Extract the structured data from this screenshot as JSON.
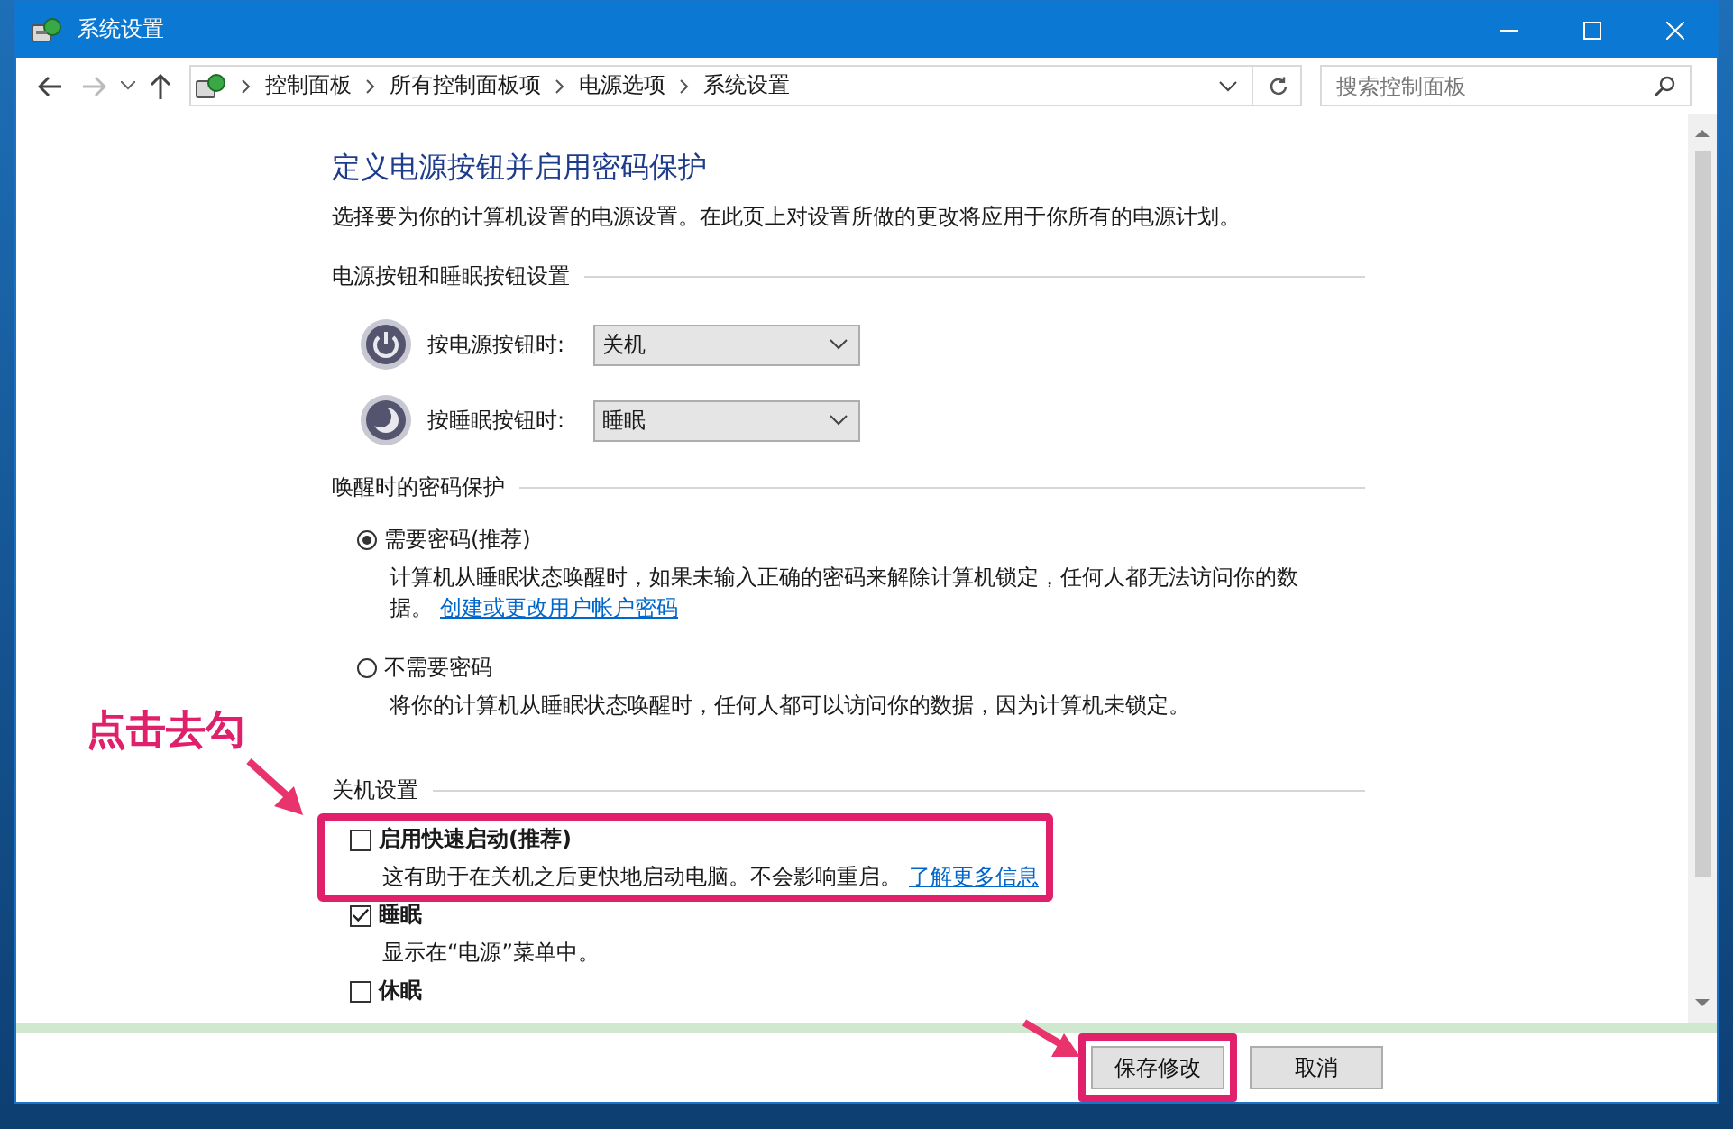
{
  "window": {
    "title": "系统设置"
  },
  "address_bar": {
    "breadcrumbs": [
      "控制面板",
      "所有控制面板项",
      "电源选项",
      "系统设置"
    ]
  },
  "search": {
    "placeholder": "搜索控制面板"
  },
  "heading": "定义电源按钮并启用密码保护",
  "description": "选择要为你的计算机设置的电源设置。在此页上对设置所做的更改将应用于你所有的电源计划。",
  "power_section": {
    "title": "电源按钮和睡眠按钮设置",
    "rows": [
      {
        "kind": "power",
        "label": "按电源按钮时:",
        "value": "关机"
      },
      {
        "kind": "sleep",
        "label": "按睡眠按钮时:",
        "value": "睡眠"
      }
    ]
  },
  "password_section": {
    "title": "唤醒时的密码保护",
    "options": [
      {
        "label": "需要密码(推荐)",
        "description": "计算机从睡眠状态唤醒时，如果未输入正确的密码来解除计算机锁定，任何人都无法访问你的数据。",
        "link": "创建或更改用户帐户密码",
        "selected": true
      },
      {
        "label": "不需要密码",
        "description": "将你的计算机从睡眠状态唤醒时，任何人都可以访问你的数据，因为计算机未锁定。",
        "selected": false
      }
    ]
  },
  "shutdown_section": {
    "title": "关机设置",
    "options": [
      {
        "label": "启用快速启动(推荐)",
        "description": "这有助于在关机之后更快地启动电脑。不会影响重启。",
        "link": "了解更多信息",
        "checked": false,
        "highlighted": true
      },
      {
        "label": "睡眠",
        "description": "显示在“电源”菜单中。",
        "checked": true,
        "highlighted": false
      },
      {
        "label": "休眠",
        "checked": false,
        "highlighted": false
      }
    ]
  },
  "buttons": [
    {
      "label": "保存修改",
      "highlighted": true
    },
    {
      "label": "取消",
      "highlighted": false
    }
  ],
  "annotation": {
    "text": "点击去勾"
  }
}
